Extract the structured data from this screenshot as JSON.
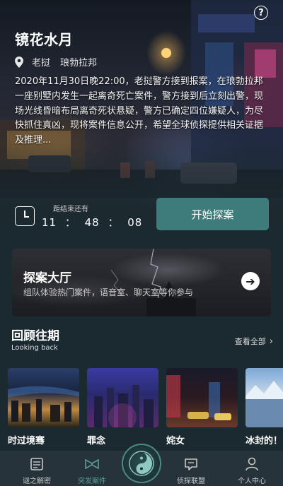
{
  "hero": {
    "help_icon": "question-circle-icon",
    "title": "镜花水月",
    "location": {
      "icon": "location-pin-icon",
      "nickname": "老挝",
      "city": "琅勃拉邦"
    },
    "description": "2020年11月30日晚22:00，老挝警方接到报案，在琅勃拉邦一座别墅内发生一起离奇死亡案件，警方接到后立刻出警，现场光线昏暗布局离奇死状悬疑，警方已确定四位嫌疑人，为尽快抓住真凶，现将案件信息公开，希望全球侦探提供相关证据及推理...",
    "countdown": {
      "icon": "clock-icon",
      "label": "距结束还有",
      "time": "11 ： 48 ： 08"
    },
    "start_button": "开始探案"
  },
  "hall": {
    "title": "探案大厅",
    "subtitle": "组队体验热门案件，语音室、聊天室等你参与",
    "icon": "arrow-right-circle-icon"
  },
  "review": {
    "title": "回顾往期",
    "subtitle": "Looking back",
    "view_all": "查看全部",
    "items": [
      {
        "label": "时过境骞"
      },
      {
        "label": "罪念"
      },
      {
        "label": "姹女"
      },
      {
        "label": "冰封的！"
      }
    ]
  },
  "tabbar": {
    "tabs": [
      {
        "label": "谜之解密",
        "icon": "newspaper-icon",
        "active": false
      },
      {
        "label": "突发案件",
        "icon": "bowtie-icon",
        "active": true
      },
      {
        "label": "侦探联盟",
        "icon": "chat-bubble-icon",
        "active": false
      },
      {
        "label": "个人中心",
        "icon": "person-icon",
        "active": false
      }
    ],
    "center_icon": "yin-yang-icon"
  },
  "colors": {
    "accent": "#3e7b7b",
    "background": "#1b2a30",
    "tab_active": "#5e9a96"
  }
}
